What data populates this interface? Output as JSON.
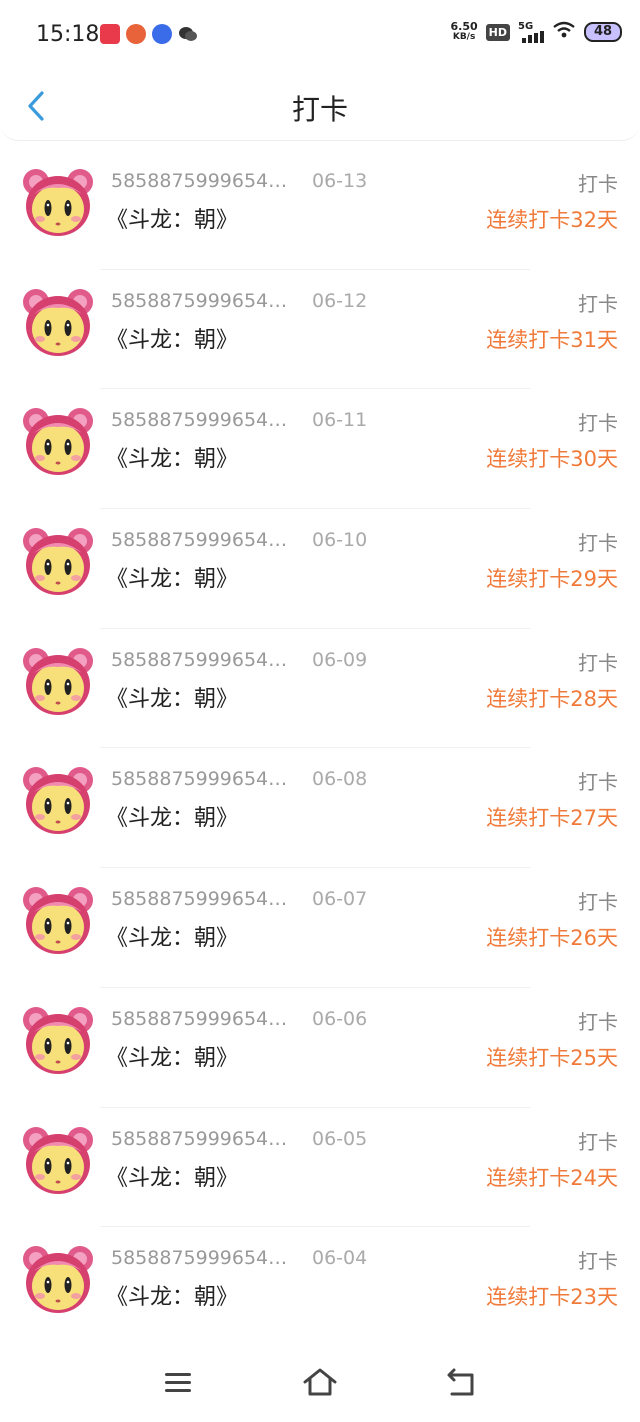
{
  "status_bar": {
    "time": "15:18",
    "net_speed_value": "6.50",
    "net_speed_unit": "KB/s",
    "hd": "HD",
    "signal": "5G",
    "battery": "48",
    "app_icons": [
      "red-app-icon",
      "orange-app-icon",
      "baidu-icon",
      "wechat-icon"
    ]
  },
  "header": {
    "title": "打卡"
  },
  "items": [
    {
      "uid": "5858875999654…",
      "date": "06-13",
      "book": "《斗龙：朝》",
      "tag": "打卡",
      "streak": "连续打卡32天"
    },
    {
      "uid": "5858875999654…",
      "date": "06-12",
      "book": "《斗龙：朝》",
      "tag": "打卡",
      "streak": "连续打卡31天"
    },
    {
      "uid": "5858875999654…",
      "date": "06-11",
      "book": "《斗龙：朝》",
      "tag": "打卡",
      "streak": "连续打卡30天"
    },
    {
      "uid": "5858875999654…",
      "date": "06-10",
      "book": "《斗龙：朝》",
      "tag": "打卡",
      "streak": "连续打卡29天"
    },
    {
      "uid": "5858875999654…",
      "date": "06-09",
      "book": "《斗龙：朝》",
      "tag": "打卡",
      "streak": "连续打卡28天"
    },
    {
      "uid": "5858875999654…",
      "date": "06-08",
      "book": "《斗龙：朝》",
      "tag": "打卡",
      "streak": "连续打卡27天"
    },
    {
      "uid": "5858875999654…",
      "date": "06-07",
      "book": "《斗龙：朝》",
      "tag": "打卡",
      "streak": "连续打卡26天"
    },
    {
      "uid": "5858875999654…",
      "date": "06-06",
      "book": "《斗龙：朝》",
      "tag": "打卡",
      "streak": "连续打卡25天"
    },
    {
      "uid": "5858875999654…",
      "date": "06-05",
      "book": "《斗龙：朝》",
      "tag": "打卡",
      "streak": "连续打卡24天"
    },
    {
      "uid": "5858875999654…",
      "date": "06-04",
      "book": "《斗龙：朝》",
      "tag": "打卡",
      "streak": "连续打卡23天"
    }
  ],
  "colors": {
    "accent_blue": "#3a9bdc",
    "streak_orange": "#f07a3a",
    "avatar_pink": "#e05a8a",
    "avatar_face": "#f7e07a"
  },
  "nav_bar": {
    "icons": [
      "menu-icon",
      "home-icon",
      "back-icon"
    ]
  }
}
